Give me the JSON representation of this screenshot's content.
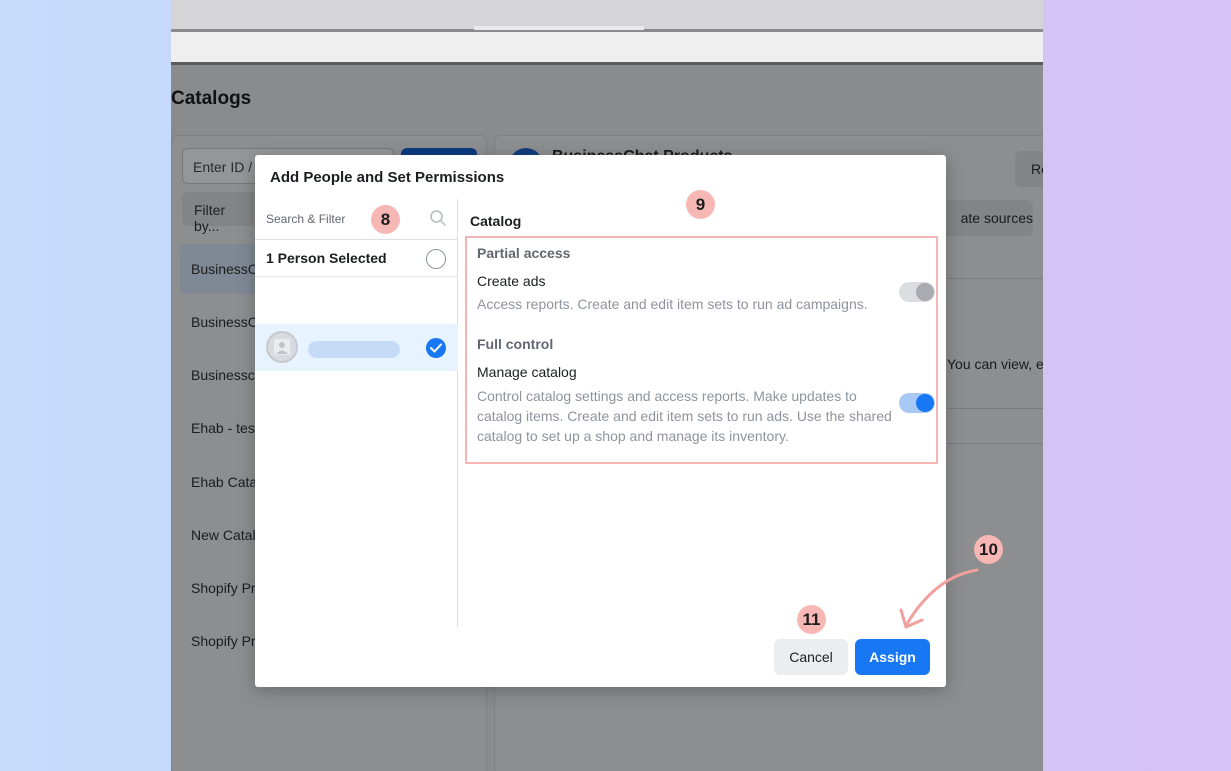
{
  "page": {
    "title": "Catalogs",
    "search_placeholder": "Enter ID / ...",
    "filter_label": "Filter by...",
    "catalog_items": [
      "BusinessC",
      "BusinessC",
      "Businesscl",
      "Ehab - test",
      "Ehab Catal",
      "New Catalo",
      "Shopify Pr",
      "Shopify Pr"
    ],
    "selected_catalog_title": "BusinessChat Products",
    "right_button_label": "Re",
    "sources_button_label": "ate sources",
    "access_text": "You can view, ed"
  },
  "modal": {
    "title": "Add People and Set Permissions",
    "search_placeholder": "Search & Filter",
    "selected_count_label": "1 Person Selected",
    "catalog_heading": "Catalog",
    "partial_section": "Partial access",
    "create_ads_title": "Create ads",
    "create_ads_desc": "Access reports. Create and edit item sets to run ad campaigns.",
    "full_section": "Full control",
    "manage_title": "Manage catalog",
    "manage_desc": "Control catalog settings and access reports. Make updates to catalog items. Create and edit item sets to run ads. Use the shared catalog to set up a shop and manage its inventory.",
    "create_ads_enabled": false,
    "manage_catalog_enabled": true,
    "cancel_label": "Cancel",
    "assign_label": "Assign"
  },
  "annotations": {
    "step8": "8",
    "step9": "9",
    "step10": "10",
    "step11": "11"
  },
  "colors": {
    "primary": "#1877f2",
    "annotation_badge": "#f7b7b5",
    "highlight_border": "#f6b4b4",
    "arrow": "#f29f9f"
  },
  "icons": {
    "search": "search-icon",
    "check": "check-circle-icon",
    "avatar": "user-avatar-icon",
    "arrow": "curved-arrow-icon"
  }
}
